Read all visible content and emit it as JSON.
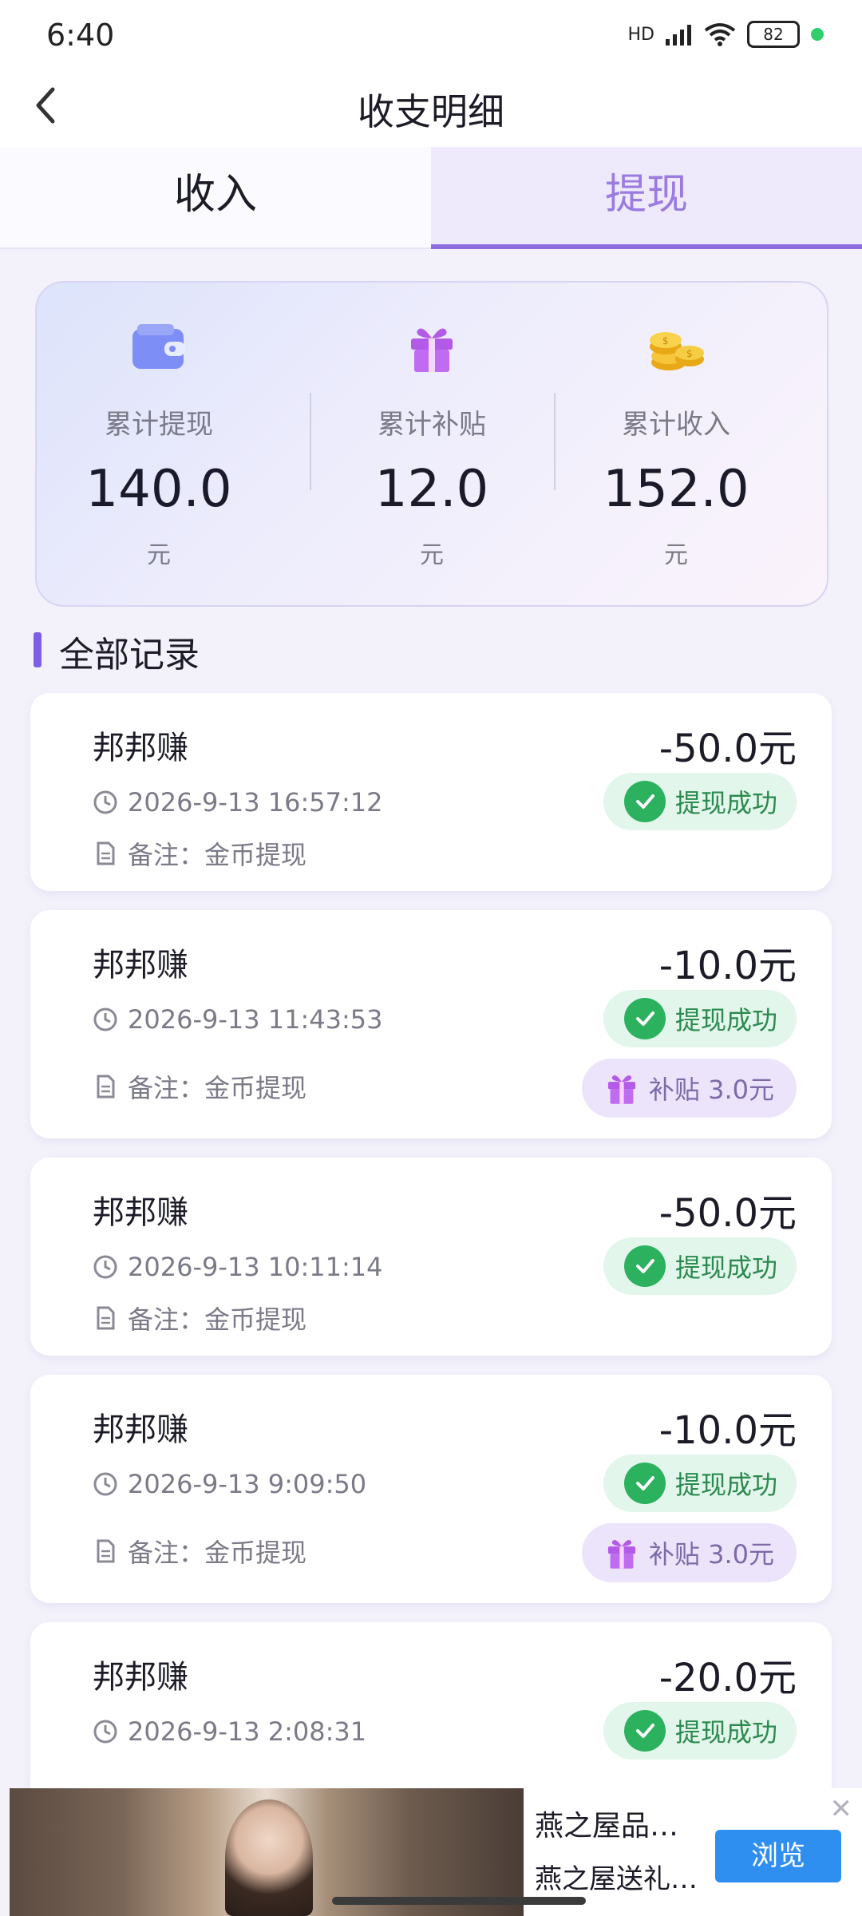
{
  "status_bar": {
    "time": "6:40",
    "signal": "HD",
    "battery": "82"
  },
  "header": {
    "title": "收支明细"
  },
  "tabs": [
    {
      "label": "收入",
      "active": false
    },
    {
      "label": "提现",
      "active": true
    }
  ],
  "summary": [
    {
      "icon": "wallet-icon",
      "label": "累计提现",
      "value": "140.0",
      "unit": "元"
    },
    {
      "icon": "gift-icon",
      "label": "累计补贴",
      "value": "12.0",
      "unit": "元"
    },
    {
      "icon": "coins-icon",
      "label": "累计收入",
      "value": "152.0",
      "unit": "元"
    }
  ],
  "section": {
    "title": "全部记录"
  },
  "records": [
    {
      "name": "邦邦赚",
      "amount": "-50.0元",
      "time": "2026-9-13 16:57:12",
      "note": "备注：金币提现",
      "status": "提现成功",
      "subsidy": ""
    },
    {
      "name": "邦邦赚",
      "amount": "-10.0元",
      "time": "2026-9-13 11:43:53",
      "note": "备注：金币提现",
      "status": "提现成功",
      "subsidy": "补贴 3.0元"
    },
    {
      "name": "邦邦赚",
      "amount": "-50.0元",
      "time": "2026-9-13 10:11:14",
      "note": "备注：金币提现",
      "status": "提现成功",
      "subsidy": ""
    },
    {
      "name": "邦邦赚",
      "amount": "-10.0元",
      "time": "2026-9-13 9:09:50",
      "note": "备注：金币提现",
      "status": "提现成功",
      "subsidy": "补贴 3.0元"
    },
    {
      "name": "邦邦赚",
      "amount": "-20.0元",
      "time": "2026-9-13 2:08:31",
      "note": "",
      "status": "提现成功",
      "subsidy": ""
    }
  ],
  "ad": {
    "line1": "燕之屋品…",
    "line2": "燕之屋送礼…",
    "button": "浏览"
  },
  "colors": {
    "accent": "#8a6ee0",
    "success": "#2cb15e",
    "subsidy_bg": "#ece4fb"
  }
}
